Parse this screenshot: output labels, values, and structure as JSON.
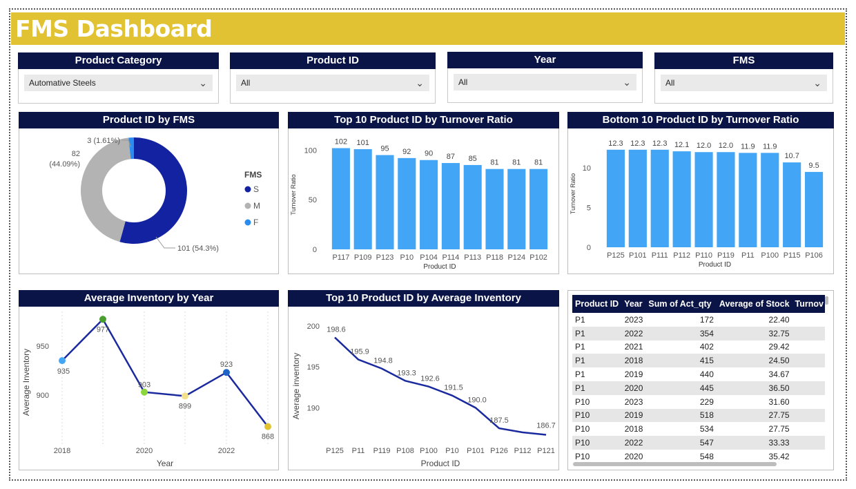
{
  "dashboard": {
    "title": "FMS Dashboard"
  },
  "slicers": [
    {
      "label": "Product Category",
      "value": "Automative Steels"
    },
    {
      "label": "Product ID",
      "value": "All"
    },
    {
      "label": "Year",
      "value": "All"
    },
    {
      "label": "FMS",
      "value": "All"
    }
  ],
  "donut": {
    "title": "Product ID by FMS",
    "legend_title": "FMS",
    "segments": [
      {
        "name": "S",
        "value": 101,
        "label": "101 (54.3%)",
        "color": "#1322a0"
      },
      {
        "name": "M",
        "value": 82,
        "label": "82\n(44.09%)",
        "color": "#b3b3b3"
      },
      {
        "name": "F",
        "value": 3,
        "label": "3 (1.61%)",
        "color": "#2b8cf0"
      }
    ]
  },
  "colors": {
    "bar": "#42a5f5",
    "line": "#1a2a9e",
    "header": "#0b1447",
    "title_bar": "#e0c232"
  },
  "chart_data": [
    {
      "type": "bar",
      "title": "Top 10 Product ID by Turnover Ratio",
      "xlabel": "Product ID",
      "ylabel": "Turnover Ratio",
      "categories": [
        "P117",
        "P109",
        "P123",
        "P10",
        "P104",
        "P114",
        "P113",
        "P118",
        "P124",
        "P102"
      ],
      "values": [
        102,
        101,
        95,
        92,
        90,
        87,
        85,
        81,
        81,
        81
      ],
      "data_labels": [
        "102",
        "101",
        "95",
        "92",
        "90",
        "87",
        "85",
        "81",
        "81",
        "81"
      ],
      "yticks": [
        "0",
        "50",
        "100"
      ],
      "ylim": [
        0,
        110
      ]
    },
    {
      "type": "bar",
      "title": "Bottom 10 Product ID by Turnover Ratio",
      "xlabel": "Product ID",
      "ylabel": "Turnover Ratio",
      "categories": [
        "P125",
        "P101",
        "P111",
        "P112",
        "P110",
        "P119",
        "P11",
        "P100",
        "P115",
        "P106"
      ],
      "values": [
        12.3,
        12.3,
        12.3,
        12.1,
        12.0,
        12.0,
        11.9,
        11.9,
        10.7,
        9.5
      ],
      "data_labels": [
        "12.3",
        "12.3",
        "12.3",
        "12.1",
        "12.0",
        "12.0",
        "11.9",
        "11.9",
        "10.7",
        "9.5"
      ],
      "yticks": [
        "0",
        "5",
        "10"
      ],
      "ylim": [
        0,
        13.5
      ]
    },
    {
      "type": "line",
      "title": "Average Inventory by Year",
      "xlabel": "Year",
      "ylabel": "Average Inventory",
      "x": [
        2018,
        2019,
        2020,
        2021,
        2022,
        2023
      ],
      "values": [
        935,
        977,
        903,
        899,
        923,
        868
      ],
      "data_labels": [
        "935",
        "977",
        "903",
        "899",
        "923",
        "868"
      ],
      "point_colors": [
        "#42a5f5",
        "#4a9e2f",
        "#8bd63a",
        "#f2e08a",
        "#1e64c8",
        "#e0c232"
      ],
      "xticks": [
        "2018",
        "2020",
        "2022"
      ],
      "yticks": [
        "900",
        "950"
      ],
      "ylim": [
        860,
        980
      ]
    },
    {
      "type": "line",
      "title": "Top 10 Product ID by Average Inventory",
      "xlabel": "Product ID",
      "ylabel": "Average inventory",
      "categories": [
        "P125",
        "P11",
        "P119",
        "P108",
        "P100",
        "P10",
        "P101",
        "P126",
        "P112",
        "P121"
      ],
      "values": [
        198.6,
        195.9,
        194.8,
        193.3,
        192.6,
        191.5,
        190.0,
        187.5,
        187.0,
        186.7
      ],
      "data_labels": [
        "198.6",
        "195.9",
        "194.8",
        "193.3",
        "192.6",
        "191.5",
        "190.0",
        "187.5",
        "",
        "186.7"
      ],
      "yticks": [
        "190",
        "195",
        "200"
      ],
      "ylim": [
        187,
        200
      ]
    }
  ],
  "table": {
    "columns": [
      "Product ID",
      "Year",
      "Sum of Act_qty",
      "Average of Stock",
      "Turnov"
    ],
    "rows": [
      [
        "P1",
        "2023",
        "172",
        "22.40"
      ],
      [
        "P1",
        "2022",
        "354",
        "32.75"
      ],
      [
        "P1",
        "2021",
        "402",
        "29.42"
      ],
      [
        "P1",
        "2018",
        "415",
        "24.50"
      ],
      [
        "P1",
        "2019",
        "440",
        "34.67"
      ],
      [
        "P1",
        "2020",
        "445",
        "36.50"
      ],
      [
        "P10",
        "2023",
        "229",
        "31.60"
      ],
      [
        "P10",
        "2019",
        "518",
        "27.75"
      ],
      [
        "P10",
        "2018",
        "534",
        "27.75"
      ],
      [
        "P10",
        "2022",
        "547",
        "33.33"
      ],
      [
        "P10",
        "2020",
        "548",
        "35.42"
      ]
    ]
  }
}
